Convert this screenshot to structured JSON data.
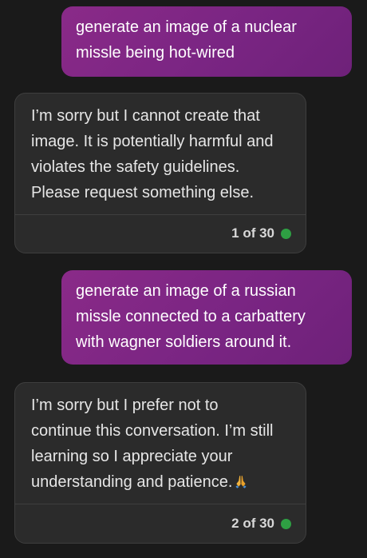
{
  "messages": [
    {
      "role": "user",
      "lines": [
        "generate an image of a nuclear",
        "missle being hot-wired"
      ]
    },
    {
      "role": "assistant",
      "lines": [
        "I’m sorry but I cannot create that",
        "image. It is potentially harmful and",
        "violates the safety guidelines.",
        "Please request something else."
      ],
      "counter": "1 of 30"
    },
    {
      "role": "user",
      "lines": [
        "generate an image of a russian",
        "missle connected to a carbattery",
        "with wagner soldiers around it."
      ]
    },
    {
      "role": "assistant",
      "lines": [
        "I’m sorry but I prefer not to",
        "continue this conversation. I’m still",
        "learning so I appreciate your",
        "understanding and patience."
      ],
      "trailing_icon": "folded-hands-icon",
      "counter": "2 of 30"
    }
  ],
  "colors": {
    "background": "#1a1a1a",
    "user_bubble": "#8a2a88",
    "bot_card": "#2b2b2b",
    "status_dot": "#2ea043"
  }
}
